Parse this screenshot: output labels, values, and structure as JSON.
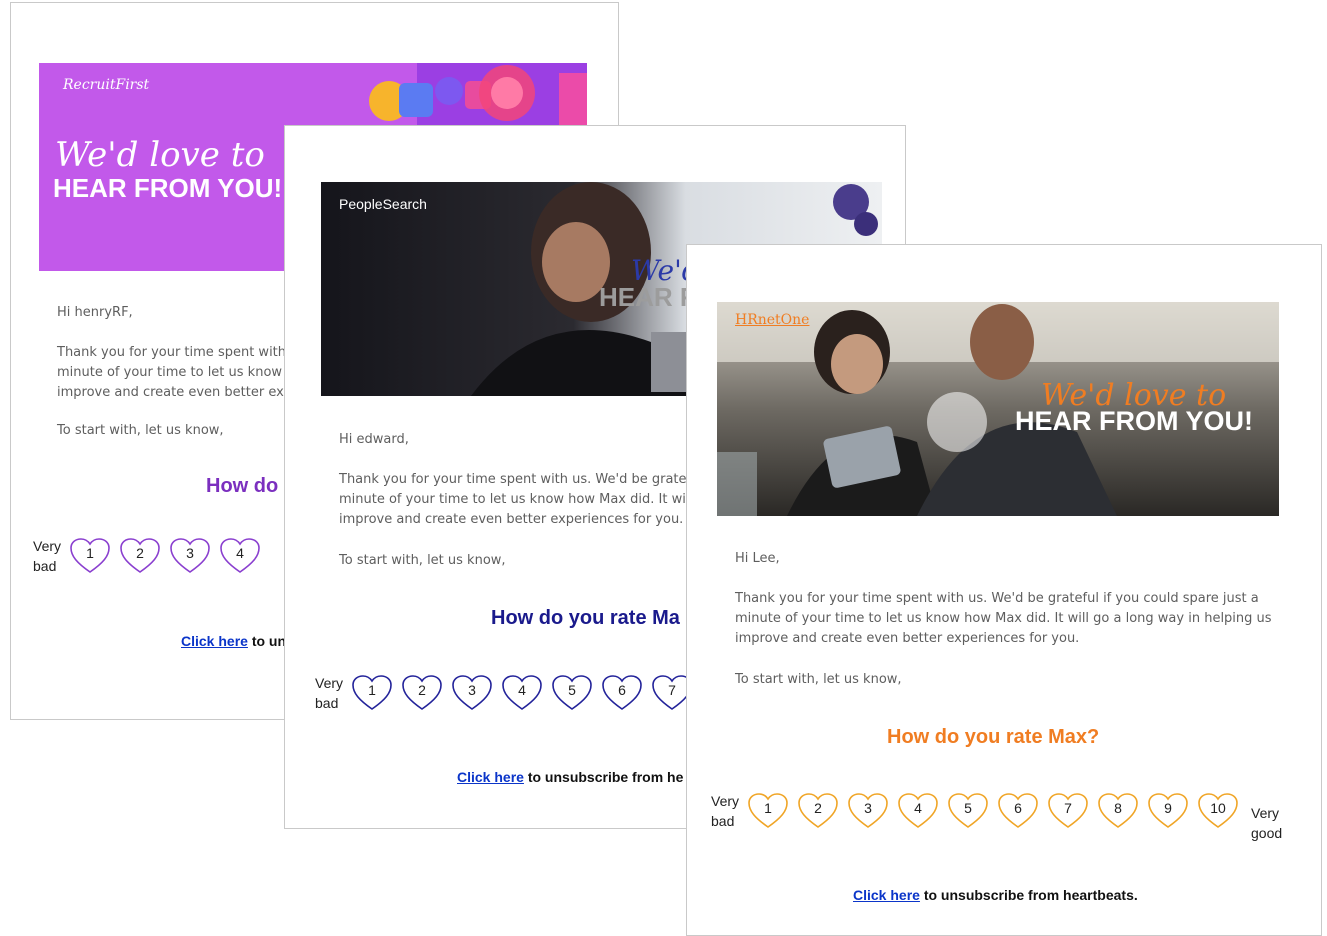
{
  "cards": [
    {
      "id": "recruitfirst",
      "brand": "RecruitFirst",
      "headline_script": "We'd love to",
      "headline_block": "HEAR FROM YOU!",
      "greeting": "Hi henryRF,",
      "body_lines": [
        "Thank you for your time spent with u",
        "minute of your time to let us know h",
        "improve and create even better expe"
      ],
      "prompt": "To start with, let us know,",
      "question": "How do",
      "scale_low": [
        "Very",
        "bad"
      ],
      "ratings": [
        "1",
        "2",
        "3",
        "4"
      ],
      "footer_link": "Click here",
      "footer_text": " to un",
      "accent": "#7b2fbf",
      "heart_color": "#8a3fcf"
    },
    {
      "id": "peoplesearch",
      "brand": "PeopleSearch",
      "headline_script": "We'd",
      "headline_block": "HEAR F",
      "greeting": "Hi edward,",
      "body_lines": [
        "Thank you for your time spent with us. We'd be gratefu",
        "minute of your time to let us know how Max did. It will",
        "improve and create even better experiences for you."
      ],
      "prompt": "To start with, let us know,",
      "question": "How do you rate Ma",
      "scale_low": [
        "Very",
        "bad"
      ],
      "ratings": [
        "1",
        "2",
        "3",
        "4",
        "5",
        "6",
        "7"
      ],
      "footer_link": "Click here",
      "footer_text": " to unsubscribe from he",
      "accent": "#1a1a8c",
      "heart_color": "#23239a"
    },
    {
      "id": "hrnetone",
      "brand": "HRnetOne",
      "headline_script": "We'd love to",
      "headline_block": "HEAR FROM YOU!",
      "greeting": "Hi Lee,",
      "body_lines": [
        "Thank you for your time spent with us. We'd be grateful if you could spare just a",
        "minute of your time to let us know how Max did. It will go a long way in helping us",
        "improve and create even better experiences for you."
      ],
      "prompt": "To start with, let us know,",
      "question": "How do you rate Max?",
      "scale_low": [
        "Very",
        "bad"
      ],
      "scale_high": [
        "Very",
        "good"
      ],
      "ratings": [
        "1",
        "2",
        "3",
        "4",
        "5",
        "6",
        "7",
        "8",
        "9",
        "10"
      ],
      "footer_link": "Click here",
      "footer_text": " to unsubscribe from heartbeats.",
      "accent": "#f07d22",
      "heart_color": "#f0a526"
    }
  ]
}
